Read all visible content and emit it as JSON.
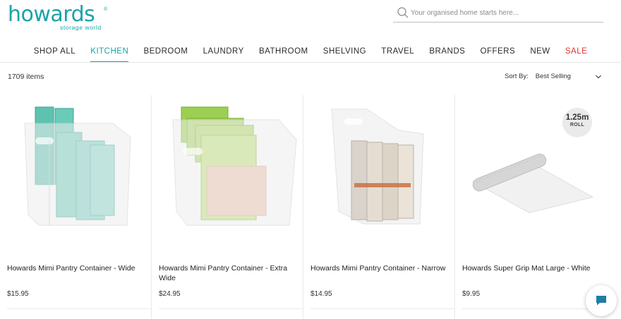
{
  "brand": {
    "name": "howards",
    "registered": "®",
    "tagline": "storage world",
    "color": "#1ba3a7"
  },
  "search": {
    "placeholder": "Your organised home starts here...",
    "value": ""
  },
  "nav": {
    "items": [
      {
        "label": "SHOP ALL"
      },
      {
        "label": "KITCHEN"
      },
      {
        "label": "BEDROOM"
      },
      {
        "label": "LAUNDRY"
      },
      {
        "label": "BATHROOM"
      },
      {
        "label": "SHELVING"
      },
      {
        "label": "TRAVEL"
      },
      {
        "label": "BRANDS"
      },
      {
        "label": "OFFERS"
      },
      {
        "label": "NEW"
      },
      {
        "label": "SALE"
      }
    ],
    "active": "KITCHEN",
    "sale_color": "#e0322e"
  },
  "listing": {
    "count": "1709 items",
    "sort_label": "Sort By:",
    "sort_value": "Best Selling"
  },
  "products": [
    {
      "name": "Howards Mimi Pantry Container - Wide",
      "price": "$15.95",
      "image_icon": "pantry-container-wide-image"
    },
    {
      "name": "Howards Mimi Pantry Container - Extra Wide",
      "price": "$24.95",
      "image_icon": "pantry-container-extra-wide-image"
    },
    {
      "name": "Howards Mimi Pantry Container - Narrow",
      "price": "$14.95",
      "image_icon": "pantry-container-narrow-image"
    },
    {
      "name": "Howards Super Grip Mat Large - White",
      "price": "$9.95",
      "image_icon": "grip-mat-roll-image",
      "badge": {
        "size": "1.25m",
        "unit": "ROLL"
      }
    }
  ],
  "chat": {
    "icon": "chat-bubble-icon",
    "color": "#1e7ea6"
  }
}
